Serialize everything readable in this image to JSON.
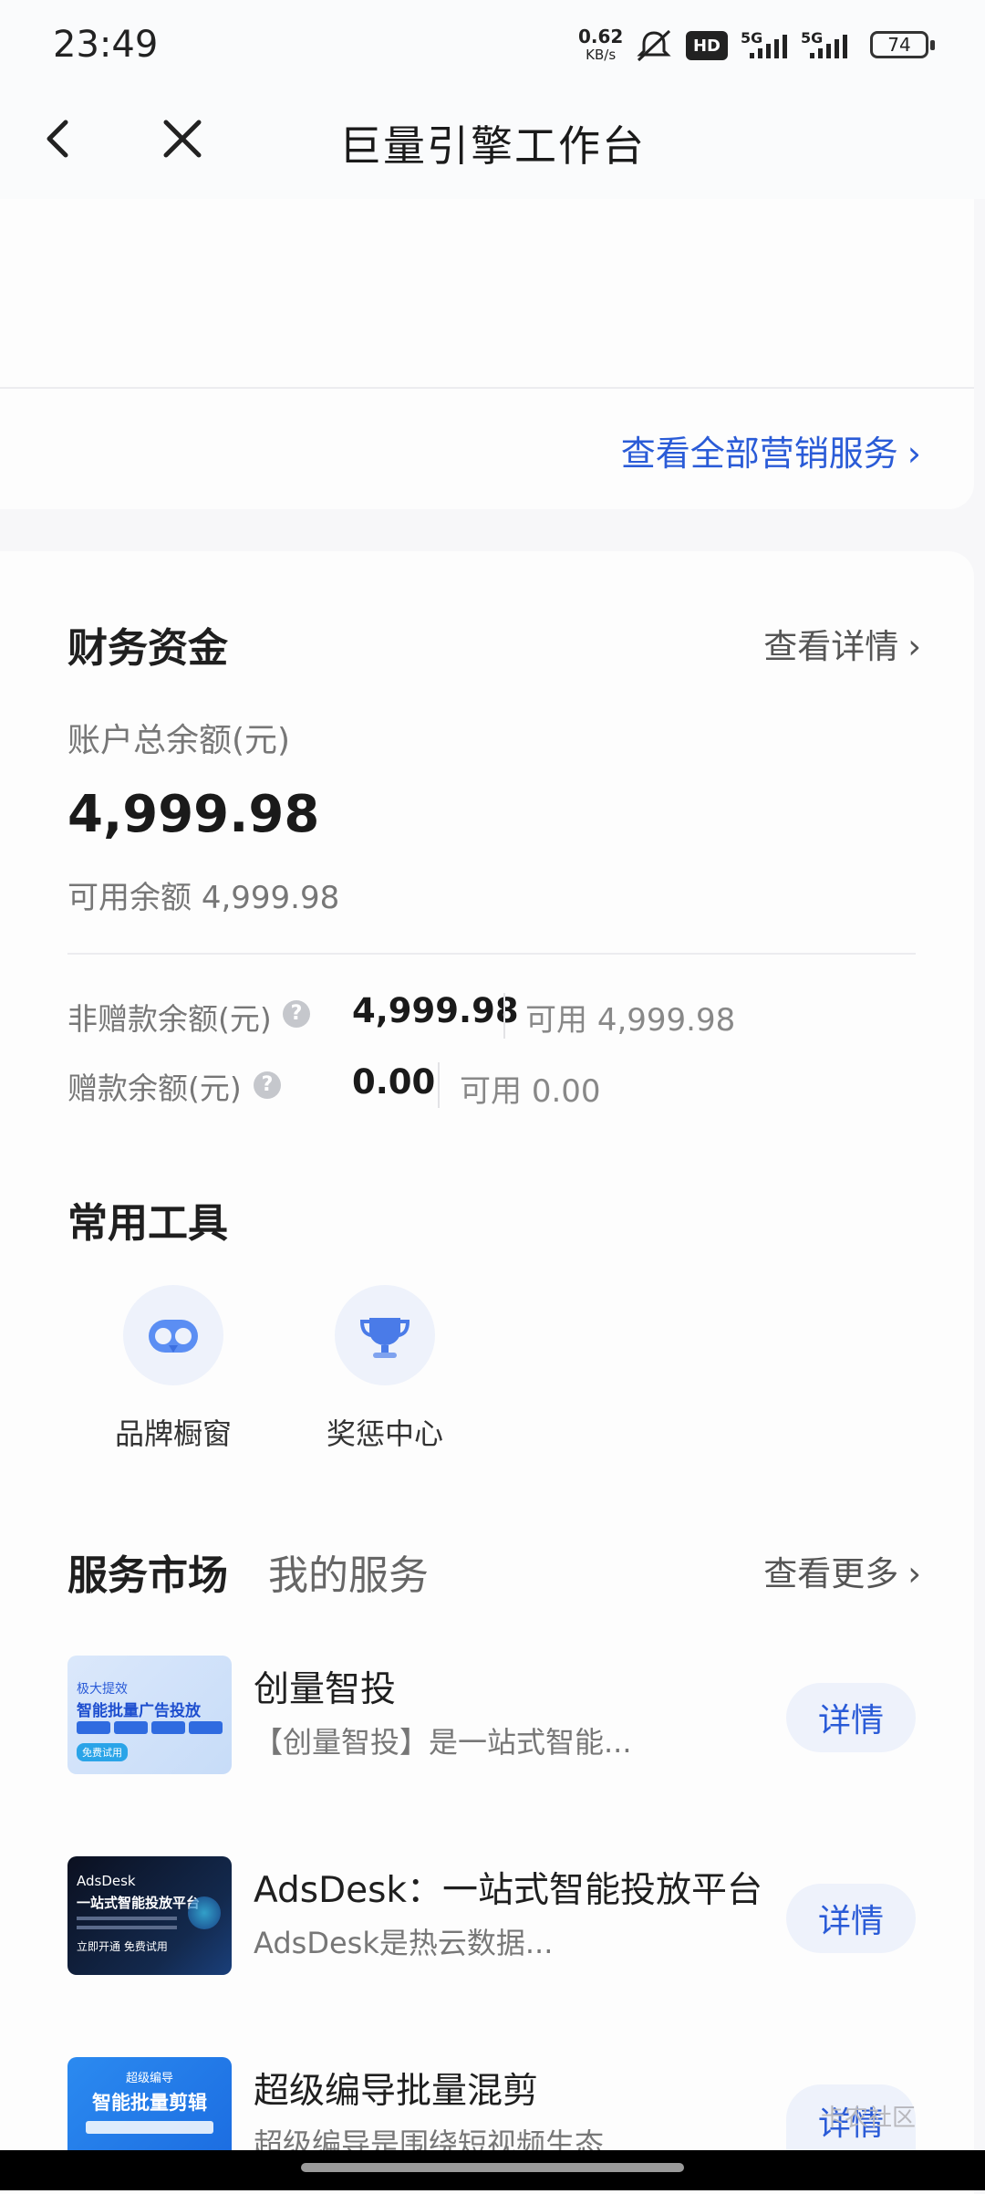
{
  "status_bar": {
    "time": "23:49",
    "net_speed": "0.62",
    "net_unit": "KB/s",
    "hd_label": "HD",
    "sig1": "5G",
    "sig2": "5G",
    "battery": "74"
  },
  "header": {
    "title": "巨量引擎工作台"
  },
  "marketing": {
    "view_all": "查看全部营销服务"
  },
  "finance": {
    "title": "财务资金",
    "details_link": "查看详情",
    "total_label": "账户总余额(元)",
    "total_amount": "4,999.98",
    "available_label": "可用余额",
    "available_amount": "4,999.98",
    "non_gift_label": "非赠款余额(元)",
    "non_gift_amount": "4,999.98",
    "non_gift_available_label": "可用",
    "non_gift_available": "4,999.98",
    "gift_label": "赠款余额(元)",
    "gift_amount": "0.00",
    "gift_available_label": "可用",
    "gift_available": "0.00"
  },
  "tools": {
    "title": "常用工具",
    "items": [
      {
        "label": "品牌橱窗",
        "icon": "brand-window-icon"
      },
      {
        "label": "奖惩中心",
        "icon": "trophy-icon"
      }
    ]
  },
  "services": {
    "tab_market": "服务市场",
    "tab_mine": "我的服务",
    "more_link": "查看更多",
    "items": [
      {
        "title": "创量智投",
        "desc": "【创量智投】是一站式智能...",
        "button": "详情",
        "thumb": {
          "line1": "极大提效",
          "line2": "智能批量广告投放",
          "tag": "免费试用"
        }
      },
      {
        "title": "AdsDesk：一站式智能投放平台",
        "desc": "AdsDesk是热云数据...",
        "button": "详情",
        "thumb": {
          "line1": "AdsDesk",
          "line2": "一站式智能投放平台",
          "tag": "立即开通 免费试用"
        }
      },
      {
        "title": "超级编导批量混剪",
        "desc": "超级编导是围绕短视频生态...",
        "button": "详情",
        "thumb": {
          "line1": "超级编导",
          "line2": "智能批量剪辑",
          "tag": ""
        }
      }
    ]
  },
  "watermark": "卡农社区"
}
